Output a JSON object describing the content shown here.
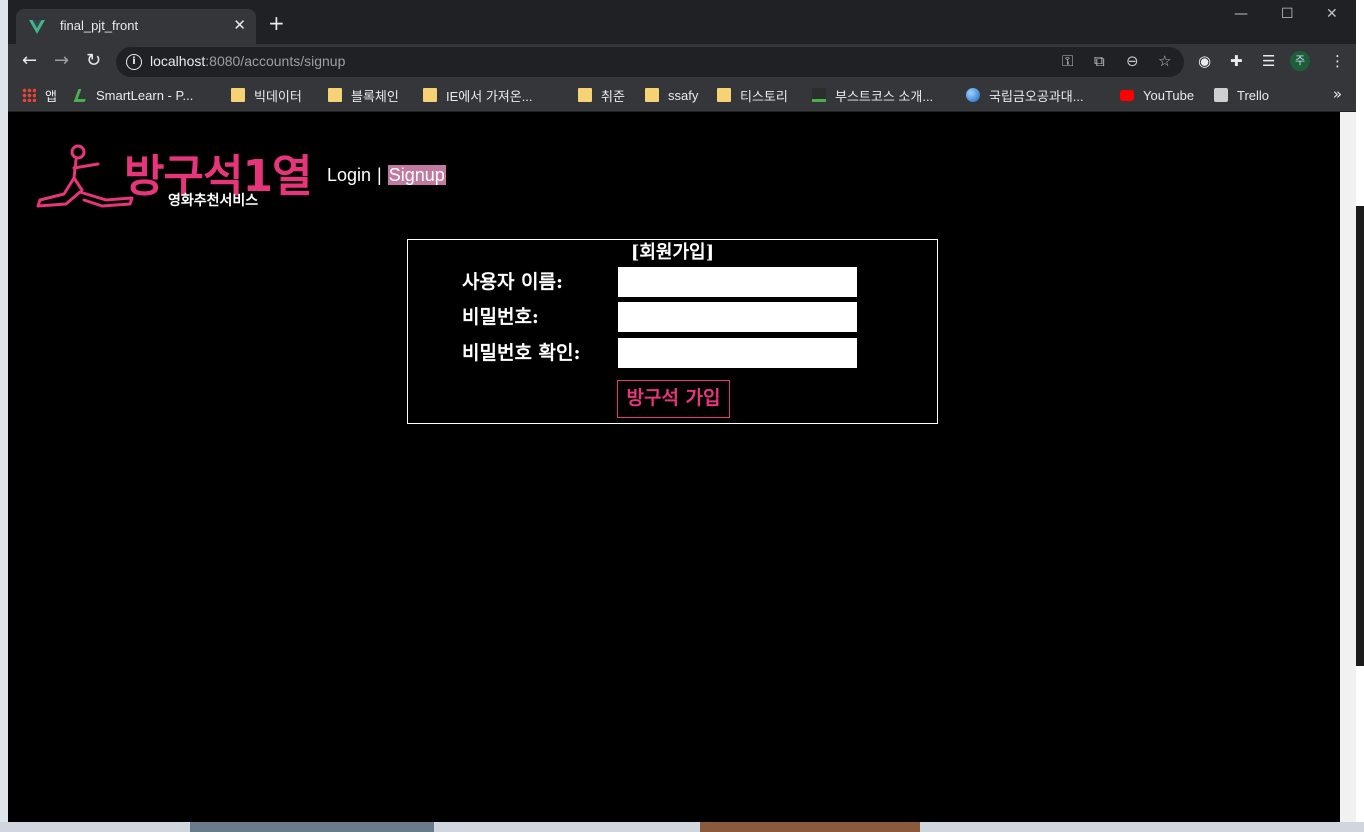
{
  "browser": {
    "tab_title": "final_pjt_front",
    "tab_close": "✕",
    "new_tab": "+",
    "url_host": "localhost",
    "url_path": ":8080/accounts/signup",
    "info_glyph": "i",
    "profile_initial": "주"
  },
  "bookmarks": [
    {
      "label": "앱",
      "icon": "apps-grid-icon"
    },
    {
      "label": "SmartLearn - P...",
      "icon": "smartlearn-icon"
    },
    {
      "label": "빅데이터",
      "icon": "folder-icon"
    },
    {
      "label": "블록체인",
      "icon": "folder-icon"
    },
    {
      "label": "IE에서 가져온...",
      "icon": "folder-icon"
    },
    {
      "label": "취준",
      "icon": "folder-icon"
    },
    {
      "label": "ssafy",
      "icon": "folder-icon"
    },
    {
      "label": "티스토리",
      "icon": "folder-icon"
    },
    {
      "label": "부스트코스 소개...",
      "icon": "boostcourse-icon"
    },
    {
      "label": "국립금오공과대...",
      "icon": "globe-icon"
    },
    {
      "label": "YouTube",
      "icon": "youtube-icon"
    },
    {
      "label": "Trello",
      "icon": "trello-icon"
    }
  ],
  "bookmarks_more": "»",
  "site": {
    "logo_title": "방구석1열",
    "logo_subtitle": "영화추천서비스",
    "nav_login": "Login",
    "nav_separator": "|",
    "nav_signup": "Signup"
  },
  "form": {
    "title": "[회원가입]",
    "username_label": "사용자 이름:",
    "password_label": "비밀번호:",
    "password_confirm_label": "비밀번호 확인:",
    "username_value": "",
    "password_value": "",
    "password_confirm_value": "",
    "submit_label": "방구석 가입"
  },
  "colors": {
    "accent": "#e6357a",
    "nav_active_bg": "#c27aa0",
    "page_bg": "#000000"
  }
}
